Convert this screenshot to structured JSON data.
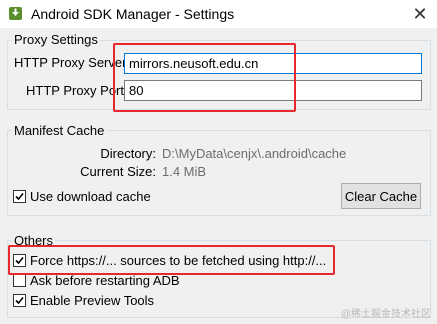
{
  "window": {
    "title": "Android SDK Manager - Settings",
    "close_glyph": "✕",
    "icon": "android-sdk-icon"
  },
  "proxy": {
    "group_title": "Proxy Settings",
    "server_label": "HTTP Proxy Server",
    "server_value": "mirrors.neusoft.edu.cn",
    "port_label": "HTTP Proxy Port",
    "port_value": "80"
  },
  "manifest": {
    "group_title": "Manifest Cache",
    "directory_label": "Directory:",
    "directory_value": "D:\\MyData\\cenjx\\.android\\cache",
    "size_label": "Current Size:",
    "size_value": "1.4 MiB",
    "use_cache_label": "Use download cache",
    "use_cache_checked": true,
    "clear_cache_label": "Clear Cache"
  },
  "others": {
    "group_title": "Others",
    "items": [
      {
        "label": "Force https://... sources to be fetched using http://...",
        "checked": true
      },
      {
        "label": "Ask before restarting ADB",
        "checked": false
      },
      {
        "label": "Enable Preview Tools",
        "checked": true
      }
    ]
  },
  "watermark": "@稀土掘金技术社区",
  "colors": {
    "highlight": "#e8282d",
    "background": "#f0f0f0",
    "focus_border": "#0078d7"
  }
}
